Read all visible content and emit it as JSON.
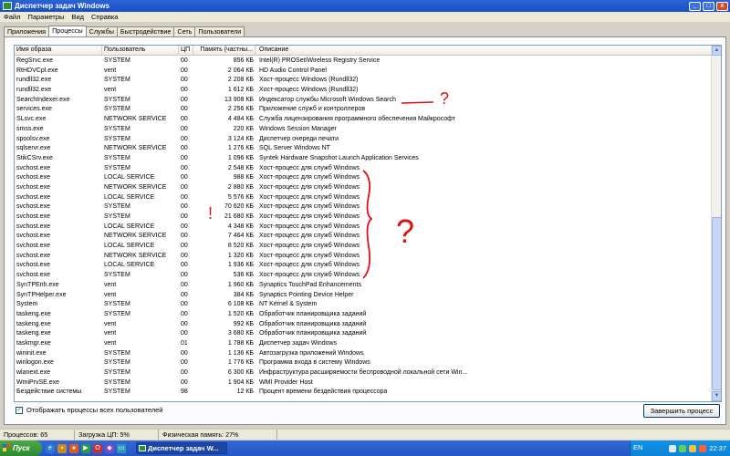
{
  "window": {
    "title": "Диспетчер задач Windows",
    "controls": {
      "minimize": "_",
      "maximize": "□",
      "close": "x"
    }
  },
  "menu": [
    "Файл",
    "Параметры",
    "Вид",
    "Справка"
  ],
  "tabs": [
    {
      "label": "Приложения",
      "active": false
    },
    {
      "label": "Процессы",
      "active": true
    },
    {
      "label": "Службы",
      "active": false
    },
    {
      "label": "Быстродействие",
      "active": false
    },
    {
      "label": "Сеть",
      "active": false
    },
    {
      "label": "Пользователи",
      "active": false
    }
  ],
  "columns": {
    "image": "Имя образа",
    "user": "Пользователь",
    "cpu": "ЦП",
    "memory": "Память (частны...",
    "description": "Описание"
  },
  "processes": [
    {
      "image": "RegSrvc.exe",
      "user": "SYSTEM",
      "cpu": "00",
      "mem": "856 КБ",
      "desc": "Intel(R) PROSet/Wireless Registry Service"
    },
    {
      "image": "RtHDVCpl.exe",
      "user": "vent",
      "cpu": "00",
      "mem": "2 064 КБ",
      "desc": "HD Audio Control Panel"
    },
    {
      "image": "rundll32.exe",
      "user": "SYSTEM",
      "cpu": "00",
      "mem": "2 208 КБ",
      "desc": "Хост-процесс Windows (Rundll32)"
    },
    {
      "image": "rundll32.exe",
      "user": "vent",
      "cpu": "00",
      "mem": "1 612 КБ",
      "desc": "Хост-процесс Windows (Rundll32)"
    },
    {
      "image": "SearchIndexer.exe",
      "user": "SYSTEM",
      "cpu": "00",
      "mem": "13 908 КБ",
      "desc": "Индексатор службы Microsoft Windows Search"
    },
    {
      "image": "services.exe",
      "user": "SYSTEM",
      "cpu": "00",
      "mem": "2 256 КБ",
      "desc": "Приложение служб и контроллеров"
    },
    {
      "image": "SLsvc.exe",
      "user": "NETWORK SERVICE",
      "cpu": "00",
      "mem": "4 484 КБ",
      "desc": "Служба лицензирования программного обеспечения Майкрософт"
    },
    {
      "image": "smss.exe",
      "user": "SYSTEM",
      "cpu": "00",
      "mem": "220 КБ",
      "desc": "Windows Session Manager"
    },
    {
      "image": "spoolsv.exe",
      "user": "SYSTEM",
      "cpu": "00",
      "mem": "3 124 КБ",
      "desc": "Диспетчер очереди печати"
    },
    {
      "image": "sqlservr.exe",
      "user": "NETWORK SERVICE",
      "cpu": "00",
      "mem": "1 276 КБ",
      "desc": "SQL Server Windows NT"
    },
    {
      "image": "StikCSrv.exe",
      "user": "SYSTEM",
      "cpu": "00",
      "mem": "1 096 КБ",
      "desc": "Syntek Hardware Snapshot Launch Application Services"
    },
    {
      "image": "svchost.exe",
      "user": "SYSTEM",
      "cpu": "00",
      "mem": "2 548 КБ",
      "desc": "Хост-процесс для служб Windows"
    },
    {
      "image": "svchost.exe",
      "user": "LOCAL SERVICE",
      "cpu": "00",
      "mem": "988 КБ",
      "desc": "Хост-процесс для служб Windows"
    },
    {
      "image": "svchost.exe",
      "user": "NETWORK SERVICE",
      "cpu": "00",
      "mem": "2 880 КБ",
      "desc": "Хост-процесс для служб Windows"
    },
    {
      "image": "svchost.exe",
      "user": "LOCAL SERVICE",
      "cpu": "00",
      "mem": "5 576 КБ",
      "desc": "Хост-процесс для служб Windows"
    },
    {
      "image": "svchost.exe",
      "user": "SYSTEM",
      "cpu": "00",
      "mem": "70 620 КБ",
      "desc": "Хост-процесс для служб Windows"
    },
    {
      "image": "svchost.exe",
      "user": "SYSTEM",
      "cpu": "00",
      "mem": "21 680 КБ",
      "desc": "Хост-процесс для служб Windows"
    },
    {
      "image": "svchost.exe",
      "user": "LOCAL SERVICE",
      "cpu": "00",
      "mem": "4 348 КБ",
      "desc": "Хост-процесс для служб Windows"
    },
    {
      "image": "svchost.exe",
      "user": "NETWORK SERVICE",
      "cpu": "00",
      "mem": "7 464 КБ",
      "desc": "Хост-процесс для служб Windows"
    },
    {
      "image": "svchost.exe",
      "user": "LOCAL SERVICE",
      "cpu": "00",
      "mem": "8 520 КБ",
      "desc": "Хост-процесс для служб Windows"
    },
    {
      "image": "svchost.exe",
      "user": "NETWORK SERVICE",
      "cpu": "00",
      "mem": "1 320 КБ",
      "desc": "Хост-процесс для служб Windows"
    },
    {
      "image": "svchost.exe",
      "user": "LOCAL SERVICE",
      "cpu": "00",
      "mem": "1 936 КБ",
      "desc": "Хост-процесс для служб Windows"
    },
    {
      "image": "svchost.exe",
      "user": "SYSTEM",
      "cpu": "00",
      "mem": "536 КБ",
      "desc": "Хост-процесс для служб Windows"
    },
    {
      "image": "SynTPEnh.exe",
      "user": "vent",
      "cpu": "00",
      "mem": "1 960 КБ",
      "desc": "Synaptics TouchPad Enhancements"
    },
    {
      "image": "SynTPHelper.exe",
      "user": "vent",
      "cpu": "00",
      "mem": "384 КБ",
      "desc": "Synaptics Pointing Device Helper"
    },
    {
      "image": "System",
      "user": "SYSTEM",
      "cpu": "00",
      "mem": "6 108 КБ",
      "desc": "NT Kernel & System"
    },
    {
      "image": "taskeng.exe",
      "user": "SYSTEM",
      "cpu": "00",
      "mem": "1 520 КБ",
      "desc": "Обработчик планировщика заданий"
    },
    {
      "image": "taskeng.exe",
      "user": "vent",
      "cpu": "00",
      "mem": "992 КБ",
      "desc": "Обработчик планировщика заданий"
    },
    {
      "image": "taskeng.exe",
      "user": "vent",
      "cpu": "00",
      "mem": "3 680 КБ",
      "desc": "Обработчик планировщика заданий"
    },
    {
      "image": "taskmgr.exe",
      "user": "vent",
      "cpu": "01",
      "mem": "1 788 КБ",
      "desc": "Диспетчер задач Windows"
    },
    {
      "image": "wininit.exe",
      "user": "SYSTEM",
      "cpu": "00",
      "mem": "1 136 КБ",
      "desc": "Автозагрузка приложений Windows"
    },
    {
      "image": "winlogon.exe",
      "user": "SYSTEM",
      "cpu": "00",
      "mem": "1 776 КБ",
      "desc": "Программа входа в систему Windows"
    },
    {
      "image": "wlanext.exe",
      "user": "SYSTEM",
      "cpu": "00",
      "mem": "6 300 КБ",
      "desc": "Инфраструктура расширяемости беспроводной локальной сети Win..."
    },
    {
      "image": "WmiPrvSE.exe",
      "user": "SYSTEM",
      "cpu": "00",
      "mem": "1 904 КБ",
      "desc": "WMI Provider Host"
    },
    {
      "image": "Бездействие системы",
      "user": "SYSTEM",
      "cpu": "98",
      "mem": "12 КБ",
      "desc": "Процент времени бездействия процессора"
    }
  ],
  "show_all_label": "Отображать процессы всех пользователей",
  "show_all_checked": true,
  "end_process_label": "Завершить процесс",
  "status": {
    "processes": "Процессов: 65",
    "cpu": "Загрузка ЦП: 5%",
    "memory": "Физическая память: 27%"
  },
  "taskbar": {
    "start_label": "Пуск",
    "task_label": "Диспетчер задач W...",
    "lang": "EN",
    "clock": "22:37"
  },
  "annotations": {
    "color": "#e01010",
    "question_mark": "?",
    "exclamation": "!"
  }
}
